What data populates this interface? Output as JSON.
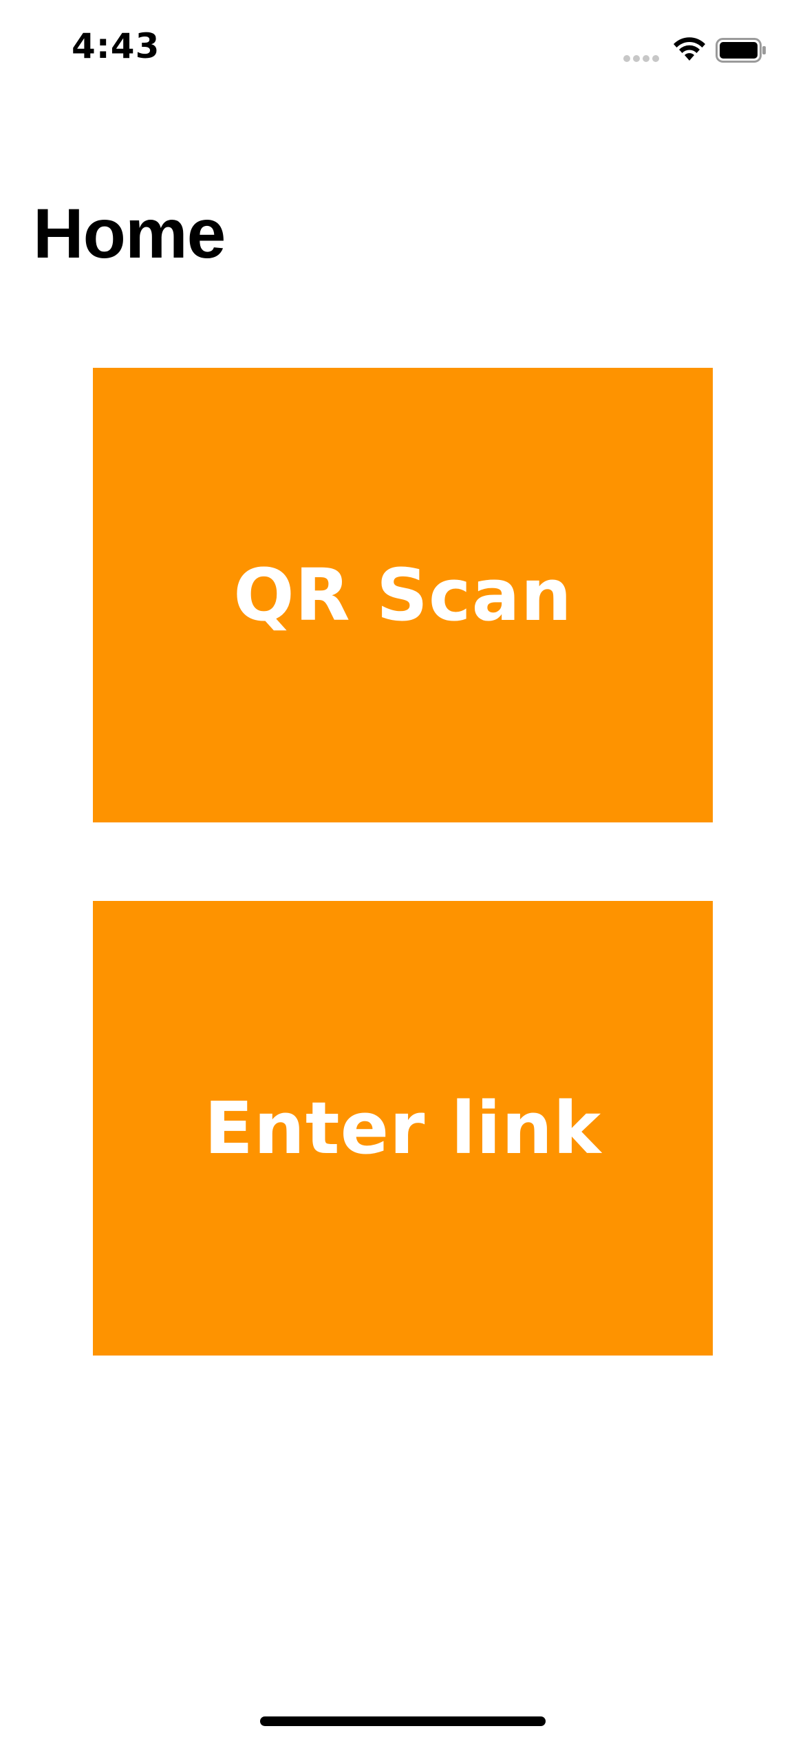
{
  "status_bar": {
    "time": "4:43",
    "icons": [
      "signal-dots-icon",
      "wifi-icon",
      "battery-icon"
    ]
  },
  "header": {
    "title": "Home"
  },
  "buttons": {
    "qr_scan_label": "QR Scan",
    "enter_link_label": "Enter link"
  },
  "colors": {
    "accent": "#fe9300",
    "button_text": "#ffffff",
    "background": "#ffffff",
    "title_text": "#000000"
  }
}
